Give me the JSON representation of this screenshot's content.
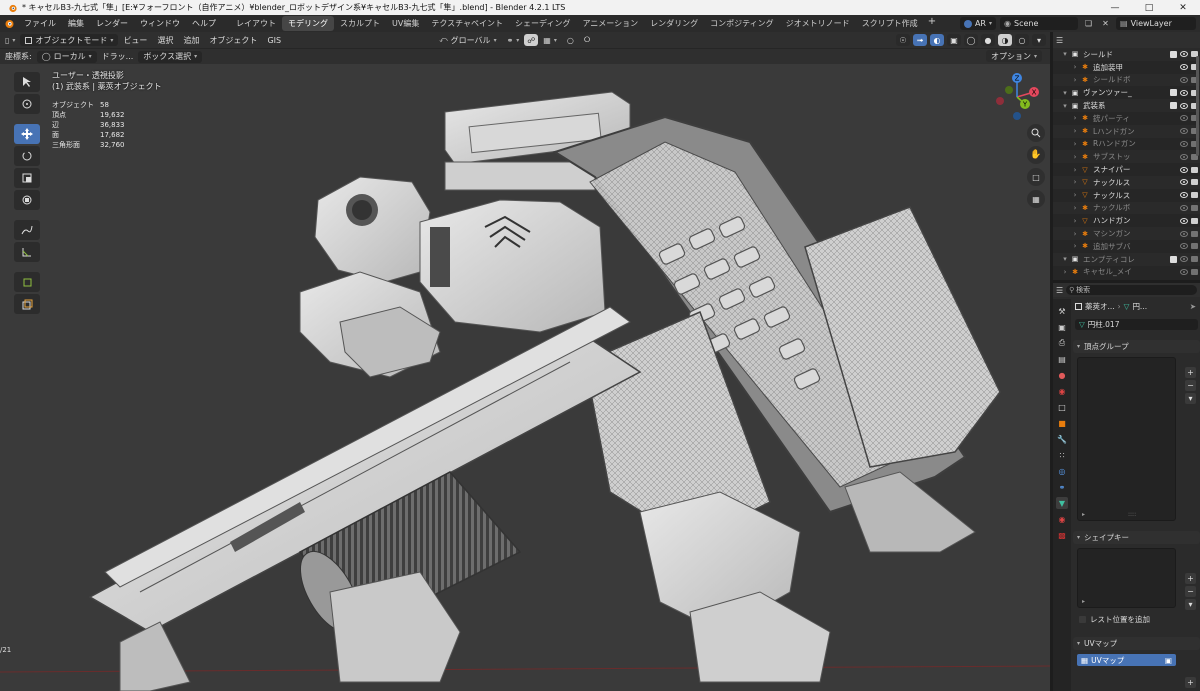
{
  "window": {
    "title": "* キャセルB3-九七式「隼」[E:¥フォーフロント（自作アニメ）¥blender_ロボットデザイン系¥キャセルB3-九七式「隼」.blend] - Blender 4.2.1 LTS"
  },
  "menubar": {
    "menus": [
      "ファイル",
      "編集",
      "レンダー",
      "ウィンドウ",
      "ヘルプ"
    ],
    "workspaces": [
      "レイアウト",
      "モデリング",
      "スカルプト",
      "UV編集",
      "テクスチャペイント",
      "シェーディング",
      "アニメーション",
      "レンダリング",
      "コンポジティング",
      "ジオメトリノード",
      "スクリプト作成"
    ],
    "active_workspace": "モデリング",
    "render_engine": "AR",
    "scene": "Scene",
    "view_layer": "ViewLayer"
  },
  "viewport_header": {
    "mode": "オブジェクトモード",
    "menus": [
      "ビュー",
      "選択",
      "追加",
      "オブジェクト",
      "GIS"
    ],
    "orientation": "グローバル",
    "coord_label": "座標系:",
    "coord_value": "ローカル",
    "drag_label": "ドラッ...",
    "drag_value": "ボックス選択",
    "options_label": "オプション"
  },
  "overlay": {
    "view_name": "ユーザー・透視投影",
    "collection_info": "(1) 武装系 | 薬莢オブジェクト",
    "stats": [
      {
        "label": "オブジェクト",
        "value": "58"
      },
      {
        "label": "頂点",
        "value": "19,632"
      },
      {
        "label": "辺",
        "value": "36,833"
      },
      {
        "label": "面",
        "value": "17,682"
      },
      {
        "label": "三角形面",
        "value": "32,760"
      }
    ]
  },
  "outliner": {
    "rows": [
      {
        "name": "シールド",
        "type": "collection",
        "dim": false
      },
      {
        "name": "追加装甲",
        "type": "armature",
        "dim": false
      },
      {
        "name": "シールドボ",
        "type": "armature",
        "dim": true
      },
      {
        "name": "ヴァンツァー_",
        "type": "collection",
        "dim": false
      },
      {
        "name": "武装系",
        "type": "collection",
        "dim": false
      },
      {
        "name": "銃パーティ",
        "type": "armature",
        "dim": true
      },
      {
        "name": "Lハンドガン",
        "type": "armature",
        "dim": true
      },
      {
        "name": "Rハンドガン",
        "type": "armature",
        "dim": true
      },
      {
        "name": "サブストッ",
        "type": "armature",
        "dim": true
      },
      {
        "name": "スナイパー",
        "type": "mesh",
        "dim": false
      },
      {
        "name": "ナックルス",
        "type": "mesh",
        "dim": false
      },
      {
        "name": "ナックルス",
        "type": "mesh",
        "dim": false
      },
      {
        "name": "ナックルボ",
        "type": "armature",
        "dim": true
      },
      {
        "name": "ハンドガン",
        "type": "mesh",
        "dim": false
      },
      {
        "name": "マシンガン",
        "type": "armature",
        "dim": true
      },
      {
        "name": "追加サブバ",
        "type": "armature",
        "dim": true
      },
      {
        "name": "エンプティコレ",
        "type": "collection",
        "dim": true
      },
      {
        "name": "キャセル_メイ",
        "type": "armature",
        "dim": true
      }
    ]
  },
  "properties": {
    "search_placeholder": "検索",
    "breadcrumb_1": "薬莢オ...",
    "breadcrumb_2": "円...",
    "data_name": "円柱.017",
    "panels": {
      "vertex_groups": "頂点グループ",
      "shape_keys": "シェイプキー",
      "relative_label": "レスト位置を追加",
      "uv_maps": "UVマップ",
      "uv_map_item": "UVマップ"
    }
  },
  "taskbar_fragment": {
    "text": "/21"
  },
  "colors": {
    "accent": "#4773b5",
    "viewport_bg": "#3a3a3a",
    "panel_bg": "#2b2b2b",
    "gizmo_x": "#e4485d",
    "gizmo_y": "#83bc1e",
    "gizmo_z": "#3f86e2"
  }
}
